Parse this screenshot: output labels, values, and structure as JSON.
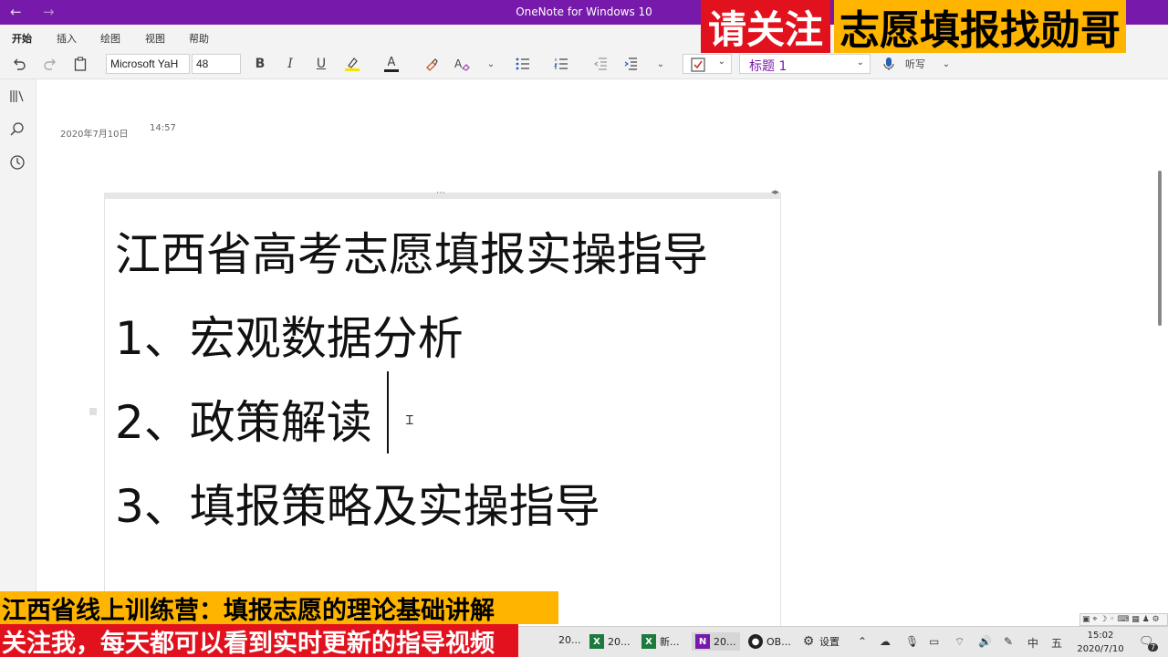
{
  "titlebar": {
    "back": "←",
    "forward": "→",
    "title": "OneNote for Windows 10"
  },
  "tabs": [
    "开始",
    "插入",
    "绘图",
    "视图",
    "帮助"
  ],
  "toolbar": {
    "font_name": "Microsoft YaH",
    "font_size": "48",
    "bold": "B",
    "italic": "I",
    "underline": "U",
    "font_color_label": "A",
    "style_label": "标题 1",
    "dictate_label": "听写",
    "accent": "#7719aa"
  },
  "page": {
    "date": "2020年7月10日",
    "time": "14:57",
    "lines": [
      "江西省高考志愿填报实操指导",
      "1、宏观数据分析",
      "2、政策解读",
      "3、填报策略及实操指导"
    ]
  },
  "overlay": {
    "top_right_red": "请关注",
    "top_right_yellow": "志愿填报找勋哥",
    "bottom_line1": "江西省线上训练营：填报志愿的理论基础讲解",
    "bottom_line2": "关注我，每天都可以看到实时更新的指导视频"
  },
  "taskbar": {
    "items": [
      {
        "label": "20...",
        "icon": "W"
      },
      {
        "label": "20...",
        "icon": "X"
      },
      {
        "label": "新...",
        "icon": "X"
      },
      {
        "label": "20...",
        "icon": "N"
      },
      {
        "label": "OB...",
        "icon": "obs"
      },
      {
        "label": "设置",
        "icon": "gear"
      }
    ],
    "ime_mode": "中",
    "ime_name": "五",
    "time": "15:02",
    "date": "2020/7/10",
    "notifications": "7"
  }
}
